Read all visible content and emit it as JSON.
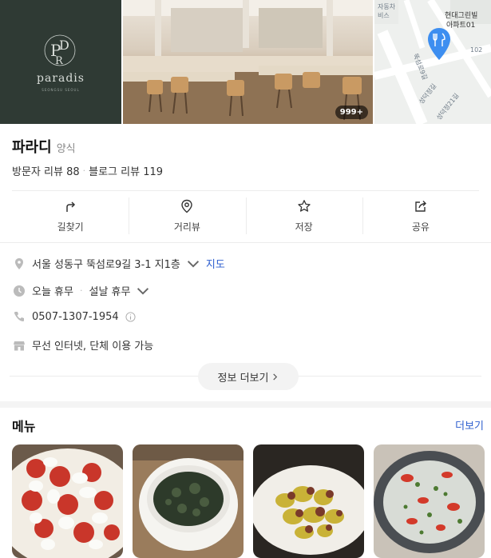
{
  "brand": {
    "logo_word": "paradis",
    "logo_sub": "SEONGSU SEOUL"
  },
  "photos": {
    "count_badge": "999+",
    "map_labels": [
      "자동차",
      "비스",
      "현대그린빌",
      "아파트01",
      "102",
      "뚝섬로9길",
      "성덕정길",
      "성덕정21길"
    ]
  },
  "place": {
    "name": "파라디",
    "category": "양식"
  },
  "reviews": {
    "visitor_label": "방문자 리뷰",
    "visitor_count": "88",
    "blog_label": "블로그 리뷰",
    "blog_count": "119"
  },
  "actions": [
    {
      "label": "길찾기",
      "icon": "directions-icon"
    },
    {
      "label": "거리뷰",
      "icon": "location-pin-icon"
    },
    {
      "label": "저장",
      "icon": "star-icon"
    },
    {
      "label": "공유",
      "icon": "share-icon"
    }
  ],
  "info": {
    "address": "서울 성동구 뚝섬로9길 3-1 지1층",
    "map_link": "지도",
    "hours": "오늘 휴무",
    "hours_note": "설날 휴무",
    "phone": "0507-1307-1954",
    "facilities": "무선 인터넷, 단체 이용 가능",
    "more_label": "정보 더보기"
  },
  "menu": {
    "title": "메뉴",
    "more": "더보기"
  },
  "colors": {
    "link": "#2d5ecf",
    "logo_bg": "#2f3a34",
    "map_pin": "#3d8ef0"
  }
}
